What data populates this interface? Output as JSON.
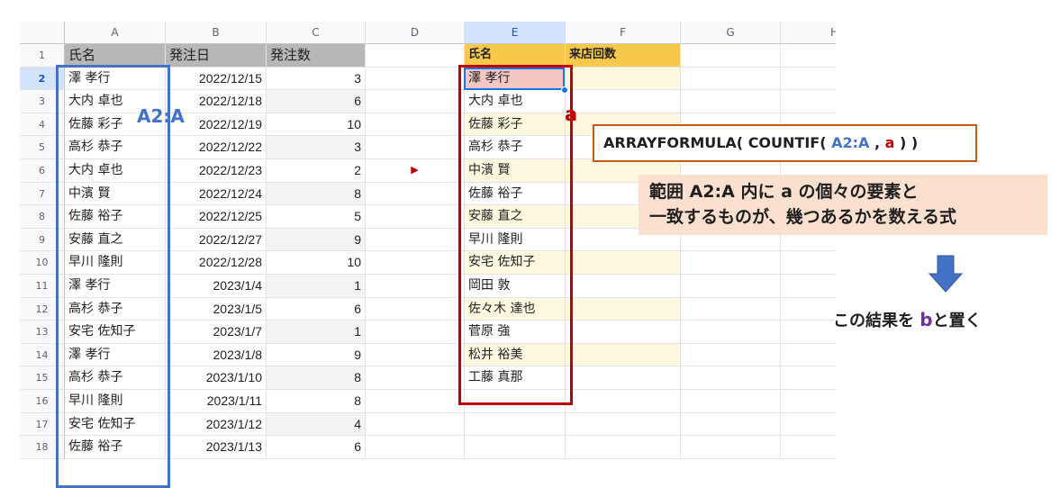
{
  "columns": [
    "A",
    "B",
    "C",
    "D",
    "E",
    "F",
    "G",
    "H"
  ],
  "rows": [
    "1",
    "2",
    "3",
    "4",
    "5",
    "6",
    "7",
    "8",
    "9",
    "10",
    "11",
    "12",
    "13",
    "14",
    "15",
    "16",
    "17",
    "18"
  ],
  "headers": {
    "a": "氏名",
    "b": "発注日",
    "c": "発注数",
    "e": "氏名",
    "f": "来店回数"
  },
  "col_a": [
    "澤 孝行",
    "大内 卓也",
    "佐藤 彩子",
    "高杉 恭子",
    "大内 卓也",
    "中濱 賢",
    "佐藤 裕子",
    "安藤 直之",
    "早川 隆則",
    "澤 孝行",
    "高杉 恭子",
    "安宅 佐知子",
    "澤 孝行",
    "高杉 恭子",
    "早川 隆則",
    "安宅 佐知子",
    "佐藤 裕子"
  ],
  "col_b": [
    "2022/12/15",
    "2022/12/18",
    "2022/12/19",
    "2022/12/22",
    "2022/12/23",
    "2022/12/24",
    "2022/12/25",
    "2022/12/27",
    "2022/12/28",
    "2023/1/4",
    "2023/1/5",
    "2023/1/7",
    "2023/1/8",
    "2023/1/10",
    "2023/1/11",
    "2023/1/12",
    "2023/1/13"
  ],
  "col_c": [
    "3",
    "6",
    "10",
    "3",
    "2",
    "8",
    "5",
    "9",
    "10",
    "1",
    "6",
    "1",
    "9",
    "8",
    "8",
    "4",
    "6"
  ],
  "col_e": [
    "澤 孝行",
    "大内 卓也",
    "佐藤 彩子",
    "高杉 恭子",
    "中濱 賢",
    "佐藤 裕子",
    "安藤 直之",
    "早川 隆則",
    "安宅 佐知子",
    "岡田 敦",
    "佐々木 達也",
    "菅原 強",
    "松井 裕美",
    "工藤 真那"
  ],
  "d6_marker": "▶",
  "labels": {
    "range": "A2:A",
    "a": "a"
  },
  "formula": {
    "prefix": "ARRAYFORMULA( COUNTIF( ",
    "range": "A2:A",
    "sep": " , ",
    "a": "a",
    "suffix": " ) )"
  },
  "description": {
    "line1": "範囲 A2:A 内に a の個々の要素と",
    "line2": "一致するものが、幾つあるかを数える式"
  },
  "result": {
    "prefix": "この結果を ",
    "b": "b",
    "suffix": "と置く"
  },
  "colors": {
    "blue": "#4472c4",
    "red": "#c00000",
    "orange": "#c55a11",
    "purple": "#7030a0",
    "sel_blue": "#1a73e8"
  }
}
